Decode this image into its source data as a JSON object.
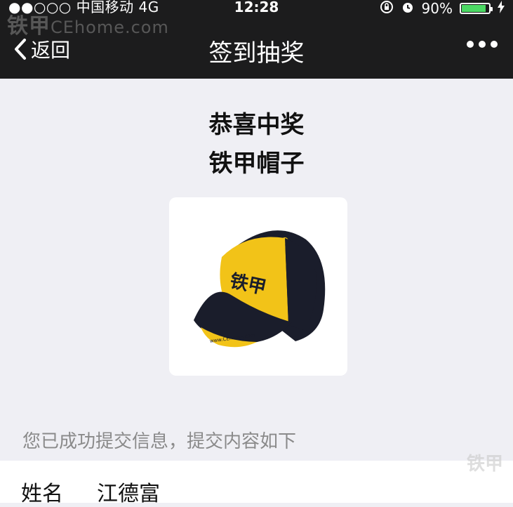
{
  "status_bar": {
    "carrier": "●●○○○ 中国移动  4G",
    "time": "12:28",
    "battery": "90%",
    "battery_level": 0.9
  },
  "watermark": {
    "brand": "铁甲",
    "site": "CEhome.com"
  },
  "nav": {
    "back_label": "返回",
    "title": "签到抽奖"
  },
  "result": {
    "line1": "恭喜中奖",
    "line2": "铁甲帽子"
  },
  "prize": {
    "cap_text": "铁甲",
    "cap_url": "www.CEhome.com"
  },
  "info": {
    "message": "您已成功提交信息，提交内容如下"
  },
  "form": {
    "name_label": "姓名",
    "name_value": "江德富"
  },
  "colors": {
    "nav_bg": "#1c1c1d",
    "page_bg": "#efeff4",
    "battery": "#4cd964",
    "cap_yellow": "#f2c318",
    "cap_navy": "#1a1d2b"
  }
}
